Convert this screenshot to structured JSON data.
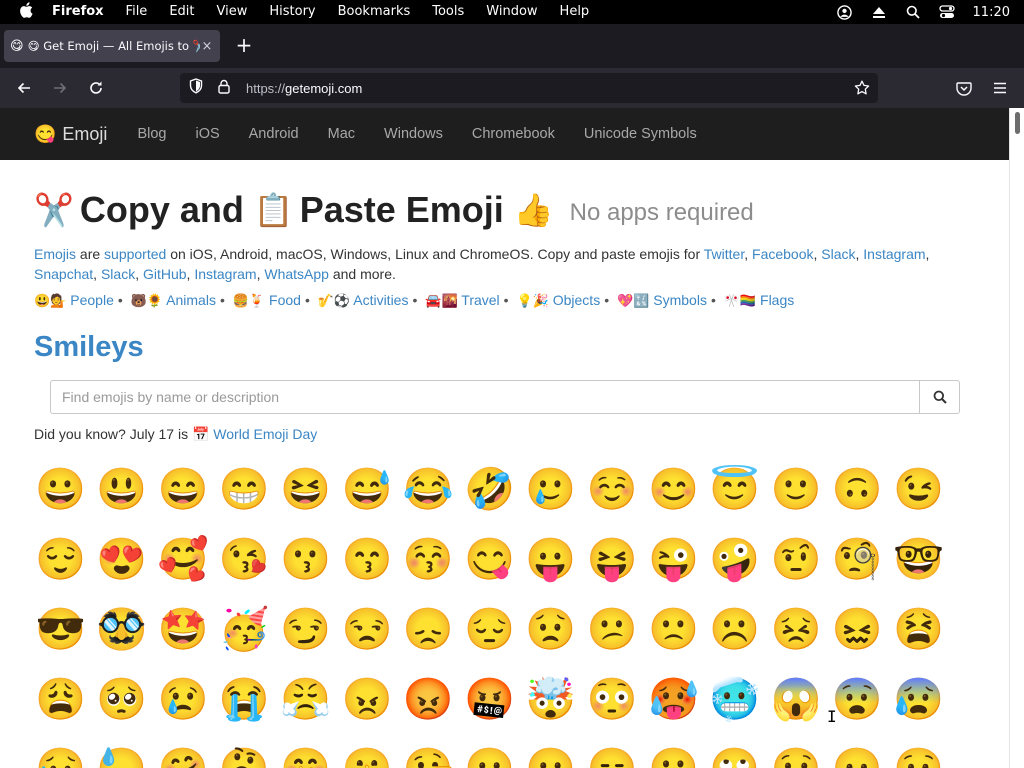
{
  "menubar": {
    "apple": "",
    "items": [
      "Firefox",
      "File",
      "Edit",
      "View",
      "History",
      "Bookmarks",
      "Tools",
      "Window",
      "Help"
    ],
    "clock": "11:20"
  },
  "tab": {
    "favicon": "😋",
    "title": "😋 Get Emoji — All Emojis to ✂️",
    "close": "×"
  },
  "newtab_label": "+",
  "url": {
    "scheme": "https://",
    "host": "getemoji.com"
  },
  "site": {
    "brand_logo": "😋",
    "brand": "Emoji",
    "nav": [
      "Blog",
      "iOS",
      "Android",
      "Mac",
      "Windows",
      "Chromebook",
      "Unicode Symbols"
    ]
  },
  "heading": {
    "e1": "✂️",
    "t1": "Copy and",
    "e2": "📋",
    "t2": "Paste Emoji",
    "e3": "👍",
    "sub": "No apps required"
  },
  "intro": {
    "emojis": "Emojis",
    "are": "are",
    "supported": "supported",
    "rest": "on iOS, Android, macOS, Windows, Linux and ChromeOS. Copy and paste emojis for",
    "links": [
      "Twitter",
      "Facebook",
      "Slack",
      "Instagram",
      "Snapchat",
      "Slack",
      "GitHub",
      "Instagram",
      "WhatsApp"
    ],
    "tail": "and more."
  },
  "categories": [
    {
      "emoji": "😃💁",
      "label": "People"
    },
    {
      "emoji": "🐻🌻",
      "label": "Animals"
    },
    {
      "emoji": "🍔🍹",
      "label": "Food"
    },
    {
      "emoji": "🎷⚽️",
      "label": "Activities"
    },
    {
      "emoji": "🚘🌇",
      "label": "Travel"
    },
    {
      "emoji": "💡🎉",
      "label": "Objects"
    },
    {
      "emoji": "💖🔣",
      "label": "Symbols"
    },
    {
      "emoji": "🎌🏳️‍🌈",
      "label": "Flags"
    }
  ],
  "section_title": "Smileys",
  "search": {
    "placeholder": "Find emojis by name or description"
  },
  "did_you_know": {
    "prefix": "Did you know? July 17 is",
    "emoji": "📅",
    "link": "World Emoji Day"
  },
  "emojis": [
    "😀",
    "😃",
    "😄",
    "😁",
    "😆",
    "😅",
    "😂",
    "🤣",
    "🥲",
    "☺️",
    "😊",
    "😇",
    "🙂",
    "🙃",
    "😉",
    "😌",
    "😍",
    "🥰",
    "😘",
    "😗",
    "😙",
    "😚",
    "😋",
    "😛",
    "😝",
    "😜",
    "🤪",
    "🤨",
    "🧐",
    "🤓",
    "😎",
    "🥸",
    "🤩",
    "🥳",
    "😏",
    "😒",
    "😞",
    "😔",
    "😟",
    "😕",
    "🙁",
    "☹️",
    "😣",
    "😖",
    "😫",
    "😩",
    "🥺",
    "😢",
    "😭",
    "😤",
    "😠",
    "😡",
    "🤬",
    "🤯",
    "😳",
    "🥵",
    "🥶",
    "😱",
    "😨",
    "😰",
    "😥",
    "😓",
    "🤗",
    "🤔",
    "🤭",
    "🤫",
    "🤥",
    "😶",
    "😐",
    "😑",
    "😬",
    "🙄",
    "😯",
    "😦",
    "😧"
  ],
  "cursor": "I"
}
